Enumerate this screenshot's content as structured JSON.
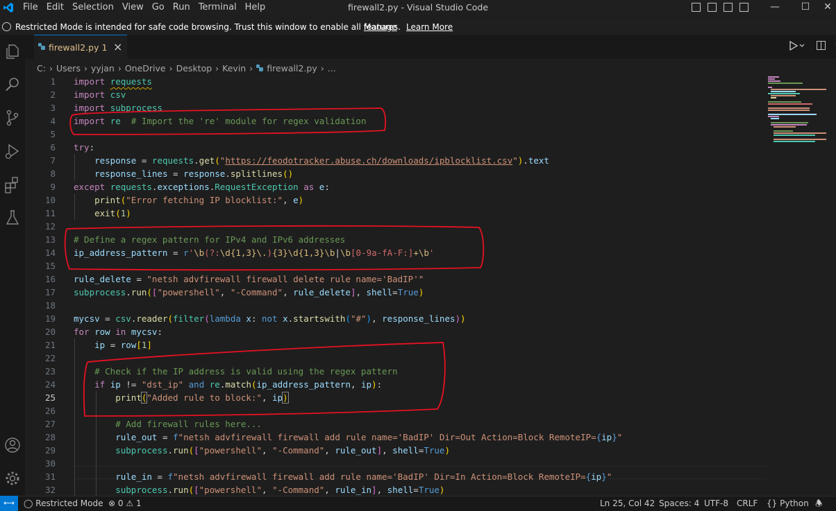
{
  "titlebar": {
    "title": "firewall2.py - Visual Studio Code",
    "menu": [
      "File",
      "Edit",
      "Selection",
      "View",
      "Go",
      "Run",
      "Terminal",
      "Help"
    ]
  },
  "banner": {
    "message": "Restricted Mode is intended for safe code browsing. Trust this window to enable all features.",
    "manage": "Manage",
    "learn_more": "Learn More"
  },
  "tab": {
    "filename": "firewall2.py",
    "problems": "1",
    "close": "×"
  },
  "breadcrumb": [
    "C:",
    "Users",
    "yyjan",
    "OneDrive",
    "Desktop",
    "Kevin",
    "firewall2.py",
    "..."
  ],
  "editor": {
    "active_line": 25,
    "line_numbers": [
      "1",
      "2",
      "3",
      "4",
      "5",
      "6",
      "7",
      "8",
      "9",
      "10",
      "11",
      "12",
      "13",
      "14",
      "15",
      "16",
      "17",
      "18",
      "19",
      "20",
      "21",
      "22",
      "23",
      "24",
      "25",
      "26",
      "27",
      "28",
      "29",
      "30",
      "31",
      "32"
    ],
    "lines": [
      "import requests",
      "import csv",
      "import subprocess",
      "import re  # Import the 're' module for regex validation",
      "",
      "try:",
      "    response = requests.get(\"https://feodotracker.abuse.ch/downloads/ipblocklist.csv\").text",
      "    response_lines = response.splitlines()",
      "except requests.exceptions.RequestException as e:",
      "    print(\"Error fetching IP blocklist:\", e)",
      "    exit(1)",
      "",
      "# Define a regex pattern for IPv4 and IPv6 addresses",
      "ip_address_pattern = r'\\b(?:\\d{1,3}\\.){3}\\d{1,3}\\b|\\b[0-9a-fA-F:]+\\b'",
      "",
      "rule_delete = \"netsh advfirewall firewall delete rule name='BadIP'\"",
      "subprocess.run([\"powershell\", \"-Command\", rule_delete], shell=True)",
      "",
      "mycsv = csv.reader(filter(lambda x: not x.startswith(\"#\"), response_lines))",
      "for row in mycsv:",
      "    ip = row[1]",
      "",
      "    # Check if the IP address is valid using the regex pattern",
      "    if ip != \"dst_ip\" and re.match(ip_address_pattern, ip):",
      "        print(\"Added rule to block:\", ip)",
      "",
      "        # Add firewall rules here...",
      "        rule_out = f\"netsh advfirewall firewall add rule name='BadIP' Dir=Out Action=Block RemoteIP={ip}\"",
      "        subprocess.run([\"powershell\", \"-Command\", rule_out], shell=True)",
      "",
      "        rule_in = f\"netsh advfirewall firewall add rule name='BadIP' Dir=In Action=Block RemoteIP={ip}\"",
      "        subprocess.run([\"powershell\", \"-Command\", rule_in], shell=True)"
    ]
  },
  "statusbar": {
    "restricted": "Restricted Mode",
    "errors": "0",
    "warnings": "1",
    "position": "Ln 25, Col 42",
    "spaces": "Spaces: 4",
    "encoding": "UTF-8",
    "eol": "CRLF",
    "language": "Python"
  },
  "colors": {
    "accent": "#0078d4",
    "annotation": "#e81123",
    "keyword": "#c586c0",
    "string": "#ce9178",
    "comment": "#6a9955"
  },
  "icons": [
    "vscode-logo-icon",
    "explorer-icon",
    "search-icon",
    "source-control-icon",
    "run-debug-icon",
    "extensions-icon",
    "testing-icon",
    "accounts-icon",
    "settings-gear-icon",
    "shield-icon",
    "python-file-icon",
    "run-icon",
    "split-editor-icon",
    "remote-icon",
    "error-icon",
    "warning-icon",
    "bell-icon"
  ]
}
